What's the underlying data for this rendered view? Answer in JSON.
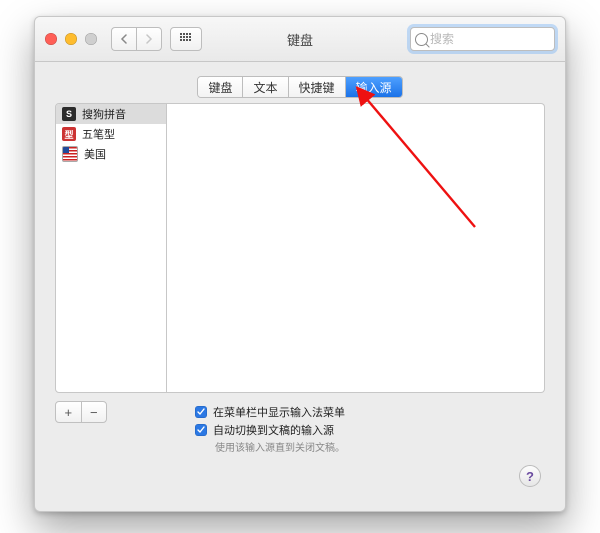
{
  "window": {
    "title": "键盘"
  },
  "toolbar": {
    "search_placeholder": "搜索",
    "search_value": ""
  },
  "tabs": [
    {
      "id": "keyboard",
      "label": "键盘"
    },
    {
      "id": "text",
      "label": "文本"
    },
    {
      "id": "shortcuts",
      "label": "快捷键"
    },
    {
      "id": "input",
      "label": "输入源",
      "active": true
    }
  ],
  "input_sources": [
    {
      "icon": "sogou",
      "label": "搜狗拼音",
      "selected": true
    },
    {
      "icon": "wubi",
      "label": "五笔型"
    },
    {
      "icon": "us",
      "label": "美国"
    }
  ],
  "addremove": {
    "add": "+",
    "remove": "−"
  },
  "options": {
    "show_in_menu_bar": {
      "checked": true,
      "label": "在菜单栏中显示输入法菜单"
    },
    "auto_switch": {
      "checked": true,
      "label": "自动切换到文稿的输入源"
    },
    "auto_switch_hint": "使用该输入源直到关闭文稿。"
  },
  "help": "?"
}
